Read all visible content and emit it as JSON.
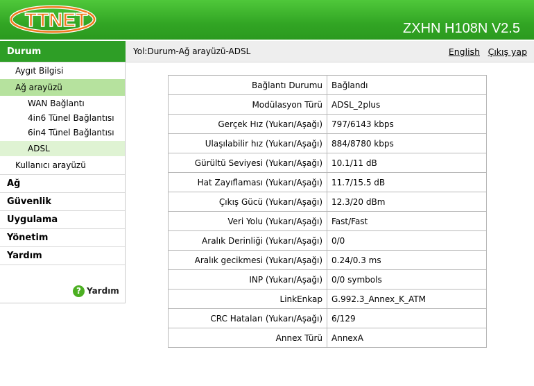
{
  "header": {
    "logo_text": "TTNET",
    "model": "ZXHN H108N V2.5"
  },
  "subbar": {
    "section": "Durum",
    "path": "Yol:Durum-Ağ arayüzü-ADSL",
    "language_link": "English",
    "logout_link": "Çıkış yap"
  },
  "sidebar": {
    "items": [
      {
        "label": "Aygıt Bilgisi"
      },
      {
        "label": "Ağ arayüzü"
      },
      {
        "label": "WAN Bağlantı"
      },
      {
        "label": "4in6 Tünel Bağlantısı"
      },
      {
        "label": "6in4 Tünel Bağlantısı"
      },
      {
        "label": "ADSL"
      },
      {
        "label": "Kullanıcı arayüzü"
      }
    ],
    "top": [
      {
        "label": "Ağ"
      },
      {
        "label": "Güvenlik"
      },
      {
        "label": "Uygulama"
      },
      {
        "label": "Yönetim"
      },
      {
        "label": "Yardım"
      }
    ],
    "help_icon": "question-icon",
    "help_label": "Yardım"
  },
  "adsl_table": {
    "rows": [
      {
        "label": "Bağlantı Durumu",
        "value": "Bağlandı"
      },
      {
        "label": "Modülasyon Türü",
        "value": "ADSL_2plus"
      },
      {
        "label": "Gerçek Hız (Yukarı/Aşağı)",
        "value": "797/6143 kbps"
      },
      {
        "label": "Ulaşılabilir hız (Yukarı/Aşağı)",
        "value": "884/8780 kbps"
      },
      {
        "label": "Gürültü Seviyesi (Yukarı/Aşağı)",
        "value": "10.1/11 dB"
      },
      {
        "label": "Hat Zayıflaması (Yukarı/Aşağı)",
        "value": "11.7/15.5 dB"
      },
      {
        "label": "Çıkış Gücü (Yukarı/Aşağı)",
        "value": "12.3/20 dBm"
      },
      {
        "label": "Veri Yolu (Yukarı/Aşağı)",
        "value": "Fast/Fast"
      },
      {
        "label": "Aralık Derinliği (Yukarı/Aşağı)",
        "value": "0/0"
      },
      {
        "label": "Aralık gecikmesi (Yukarı/Aşağı)",
        "value": "0.24/0.3 ms"
      },
      {
        "label": "INP (Yukarı/Aşağı)",
        "value": "0/0 symbols"
      },
      {
        "label": "LinkEnkap",
        "value": "G.992.3_Annex_K_ATM"
      },
      {
        "label": "CRC Hataları (Yukarı/Aşağı)",
        "value": "6/129"
      },
      {
        "label": "Annex Türü",
        "value": "AnnexA"
      }
    ]
  },
  "colors": {
    "header_green": "#32a524",
    "section_green": "#2e9e26",
    "selected_item": "#b6e29e",
    "logo_orange": "#f07a1c"
  }
}
